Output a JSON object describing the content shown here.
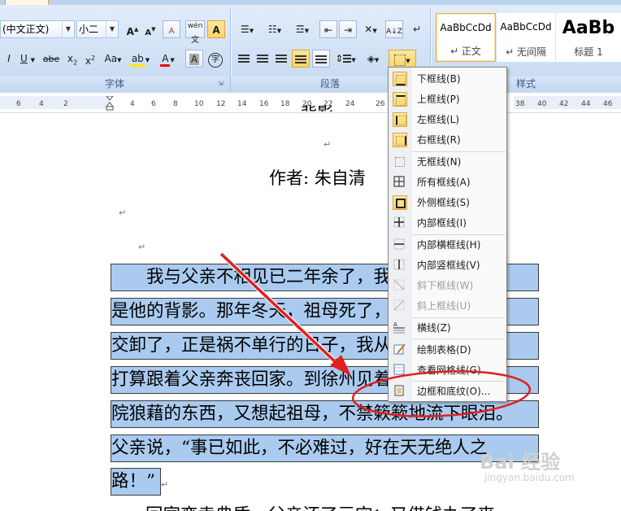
{
  "ribbon": {
    "font_name": "(中文正文)",
    "font_size": "小二",
    "group_font": "字体",
    "group_paragraph": "段落",
    "group_styles": "样式",
    "styles": [
      {
        "sample": "AaBbCcDd",
        "name": "↵ 正文"
      },
      {
        "sample": "AaBbCcDd",
        "name": "↵ 无间隔"
      },
      {
        "sample": "AaBb",
        "name": "标题 1"
      }
    ],
    "icons": {
      "grow": "A↑",
      "shrink": "A↓",
      "clear": "A",
      "phonetic": "wén",
      "charborder": "A",
      "italic": "I",
      "underline": "U",
      "strike": "abe",
      "sub": "x₂",
      "sup": "x²",
      "case": "Aa",
      "shade": "A",
      "enclose": "字"
    }
  },
  "ruler": {
    "left_ticks": [
      "6",
      "4",
      "2"
    ],
    "right_ticks": [
      "4",
      "6",
      "8",
      "10",
      "12",
      "14",
      "16",
      "18",
      "20",
      "22",
      "24",
      "26",
      "38",
      "40",
      "42",
      "44",
      "46"
    ]
  },
  "document": {
    "title_partial": "背影",
    "author": "作者: 朱自清",
    "para_mark": "↵",
    "selected_lines": [
      "　　我与父亲不相见已二年余了，我最不能忘记的",
      "是他的背影。那年冬天，祖母死了，父亲的差使也",
      "交卸了，正是祸不单行的日子，我从北京到徐州，",
      "打算跟着父亲奔丧回家。到徐州见着父亲，看见满",
      "院狼藉的东西，又想起祖母，不禁簌簌地流下眼泪。",
      "父亲说，“事已如此，不必难过，好在天无绝人之",
      "路！”"
    ],
    "next_line": "　　回家变卖典质，父亲还了亏空；又借钱办了丧"
  },
  "border_menu": {
    "items": [
      {
        "label": "下框线(B)",
        "icon": "bottom-border-icon",
        "highlight": true,
        "disabled": false
      },
      {
        "label": "上框线(P)",
        "icon": "top-border-icon",
        "highlight": true,
        "disabled": false
      },
      {
        "label": "左框线(L)",
        "icon": "left-border-icon",
        "highlight": true,
        "disabled": false
      },
      {
        "label": "右框线(R)",
        "icon": "right-border-icon",
        "highlight": true,
        "disabled": false
      },
      {
        "label": "无框线(N)",
        "icon": "no-border-icon",
        "highlight": false,
        "disabled": false
      },
      {
        "label": "所有框线(A)",
        "icon": "all-borders-icon",
        "highlight": false,
        "disabled": false
      },
      {
        "label": "外侧框线(S)",
        "icon": "outside-borders-icon",
        "highlight": true,
        "disabled": false
      },
      {
        "label": "内部框线(I)",
        "icon": "inside-borders-icon",
        "highlight": false,
        "disabled": false
      },
      {
        "label": "内部横框线(H)",
        "icon": "inside-horizontal-border-icon",
        "highlight": false,
        "disabled": false
      },
      {
        "label": "内部竖框线(V)",
        "icon": "inside-vertical-border-icon",
        "highlight": false,
        "disabled": false
      },
      {
        "label": "斜下框线(W)",
        "icon": "diagonal-down-border-icon",
        "highlight": false,
        "disabled": true
      },
      {
        "label": "斜上框线(U)",
        "icon": "diagonal-up-border-icon",
        "highlight": false,
        "disabled": true
      },
      {
        "label": "横线(Z)",
        "icon": "horizontal-line-icon",
        "highlight": false,
        "disabled": false
      },
      {
        "label": "绘制表格(D)",
        "icon": "draw-table-icon",
        "highlight": false,
        "disabled": false
      },
      {
        "label": "查看网格线(G)",
        "icon": "view-gridlines-icon",
        "highlight": false,
        "disabled": false
      },
      {
        "label": "边框和底纹(O)...",
        "icon": "borders-shading-icon",
        "highlight": false,
        "disabled": false
      }
    ]
  },
  "watermark": {
    "brand": "Bai 经验",
    "url": "jingyan.baidu.com"
  },
  "colors": {
    "selection": "#aacbef",
    "annotation": "#e02020",
    "highlight": "#fbd66b"
  }
}
